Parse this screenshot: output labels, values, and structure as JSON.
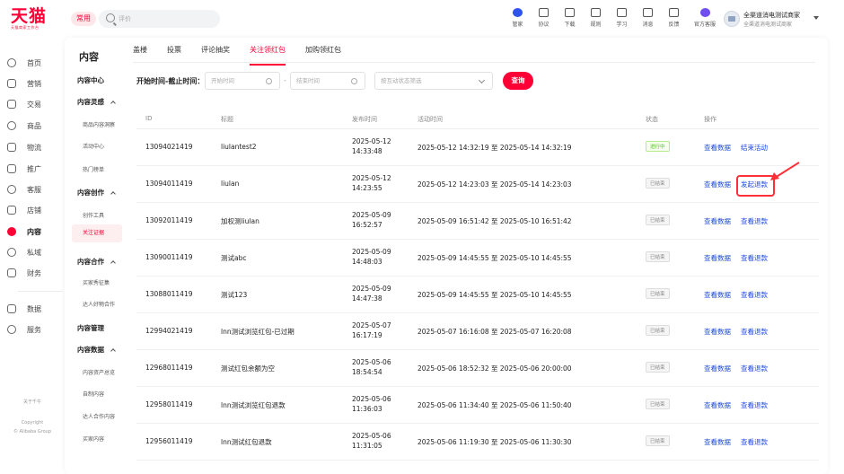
{
  "brand": {
    "logo": "天猫",
    "logo_sub": "天猫商家工作台"
  },
  "header": {
    "common_label": "常用",
    "search_placeholder": "评价",
    "tools": [
      {
        "label": "管家",
        "icon": "butler-icon"
      },
      {
        "label": "协议",
        "icon": "agreement-icon"
      },
      {
        "label": "下载",
        "icon": "download-icon"
      },
      {
        "label": "规则",
        "icon": "rules-icon"
      },
      {
        "label": "学习",
        "icon": "learn-icon"
      },
      {
        "label": "消息",
        "icon": "message-icon"
      },
      {
        "label": "反馈",
        "icon": "feedback-icon"
      },
      {
        "label": "官方客服",
        "icon": "service-icon"
      }
    ],
    "account_name": "全渠道消电测试商家",
    "account_sub": "全渠道消电测试商家"
  },
  "sidebar": {
    "items": [
      {
        "label": "首页",
        "icon": "home-icon"
      },
      {
        "label": "营销",
        "icon": "marketing-icon"
      },
      {
        "label": "交易",
        "icon": "trade-icon"
      },
      {
        "label": "商品",
        "icon": "product-icon"
      },
      {
        "label": "物流",
        "icon": "logistics-icon"
      },
      {
        "label": "推广",
        "icon": "promotion-icon"
      },
      {
        "label": "客服",
        "icon": "customer-service-icon"
      },
      {
        "label": "店铺",
        "icon": "store-icon"
      },
      {
        "label": "内容",
        "icon": "content-icon",
        "active": true
      },
      {
        "label": "私域",
        "icon": "private-domain-icon"
      },
      {
        "label": "财务",
        "icon": "finance-icon"
      },
      {
        "label": "数据",
        "icon": "data-icon"
      },
      {
        "label": "服务",
        "icon": "services-icon"
      }
    ],
    "footer_about": "关于千牛",
    "footer_copyright": "Copyright",
    "footer_company": "© Alibaba Group"
  },
  "main": {
    "title": "内容",
    "tabs": [
      "盖楼",
      "投票",
      "评论抽奖",
      "关注领红包",
      "加购领红包"
    ],
    "active_tab": "关注领红包"
  },
  "subnav": {
    "sections": [
      {
        "label": "内容中心",
        "type": "h"
      },
      {
        "label": "内容灵感",
        "type": "h",
        "chev": true
      },
      {
        "label": "商品内容洞察",
        "type": "s"
      },
      {
        "label": "活动中心",
        "type": "s"
      },
      {
        "label": "热门榜单",
        "type": "s"
      },
      {
        "label": "内容创作",
        "type": "h",
        "chev": true
      },
      {
        "label": "创作工具",
        "type": "s"
      },
      {
        "label": "关注证据",
        "type": "s",
        "active": true
      },
      {
        "label": "内容合作",
        "type": "h",
        "chev": true
      },
      {
        "label": "买家秀征集",
        "type": "s"
      },
      {
        "label": "达人好物合作",
        "type": "s"
      },
      {
        "label": "内容管理",
        "type": "h"
      },
      {
        "label": "内容数据",
        "type": "h",
        "chev": true
      },
      {
        "label": "内容资产总览",
        "type": "s"
      },
      {
        "label": "自制内容",
        "type": "s"
      },
      {
        "label": "达人合作内容",
        "type": "s"
      },
      {
        "label": "买家内容",
        "type": "s"
      }
    ]
  },
  "filters": {
    "label": "开始时间-截止时间：",
    "start_placeholder": "开始时间",
    "end_placeholder": "结束时间",
    "range_sep": "-",
    "status_placeholder": "按互动状态筛选",
    "query_label": "查询"
  },
  "table": {
    "headers": [
      "ID",
      "标题",
      "发布时间",
      "活动时间",
      "状态",
      "操作"
    ],
    "rows": [
      {
        "id": "13094021419",
        "title": "liulantest2",
        "pub": "2025-05-12 14:33:48",
        "period": "2025-05-12 14:32:19 至 2025-05-14 14:32:19",
        "status": "进行中",
        "live": true,
        "op1": "查看数据",
        "op2": "结束活动"
      },
      {
        "id": "13094011419",
        "title": "liulan",
        "pub": "2025-05-12 14:23:55",
        "period": "2025-05-12 14:23:03 至 2025-05-14 14:23:03",
        "status": "已结束",
        "live": false,
        "op1": "查看数据",
        "op2": "发起退款"
      },
      {
        "id": "13092011419",
        "title": "加权测liulan",
        "pub": "2025-05-09 16:52:57",
        "period": "2025-05-09 16:51:42 至 2025-05-10 16:51:42",
        "status": "已结束",
        "live": false,
        "op1": "查看数据",
        "op2": "查看退款"
      },
      {
        "id": "13090011419",
        "title": "测试abc",
        "pub": "2025-05-09 14:48:03",
        "period": "2025-05-09 14:45:55 至 2025-05-10 14:45:55",
        "status": "已结束",
        "live": false,
        "op1": "查看数据",
        "op2": "查看退款"
      },
      {
        "id": "13088011419",
        "title": "测试123",
        "pub": "2025-05-09 14:47:38",
        "period": "2025-05-09 14:45:55 至 2025-05-10 14:45:55",
        "status": "已结束",
        "live": false,
        "op1": "查看数据",
        "op2": "查看退款"
      },
      {
        "id": "12994021419",
        "title": "lnn测试浏览红包-已过期",
        "pub": "2025-05-07 16:17:19",
        "period": "2025-05-07 16:16:08 至 2025-05-07 16:20:08",
        "status": "已结束",
        "live": false,
        "op1": "查看数据",
        "op2": "查看退款"
      },
      {
        "id": "12968011419",
        "title": "测试红包余额为空",
        "pub": "2025-05-06 18:54:54",
        "period": "2025-05-06 18:52:32 至 2025-05-06 20:00:00",
        "status": "已结束",
        "live": false,
        "op1": "查看数据",
        "op2": "查看退款"
      },
      {
        "id": "12958011419",
        "title": "lnn测试浏览红包退款",
        "pub": "2025-05-06 11:36:03",
        "period": "2025-05-06 11:34:40 至 2025-05-06 11:50:40",
        "status": "已结束",
        "live": false,
        "op1": "查看数据",
        "op2": "查看退款"
      },
      {
        "id": "12956011419",
        "title": "lnn测试红包退款",
        "pub": "2025-05-06 11:31:05",
        "period": "2025-05-06 11:19:30 至 2025-05-06 11:30:30",
        "status": "已结束",
        "live": false,
        "op1": "查看数据",
        "op2": "查看退款"
      }
    ]
  },
  "colors": {
    "brand": "#ff0036",
    "link": "#1f49e0",
    "highlight": "#ff2f38"
  }
}
